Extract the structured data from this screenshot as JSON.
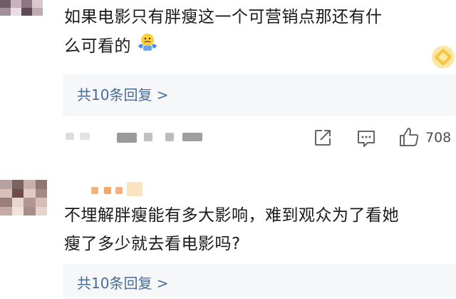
{
  "comments": [
    {
      "text_line1": "如果电影只有胖瘦这一个可营销点那还有什",
      "text_line2": "么可看的",
      "emoji": "shrug-emoji",
      "replies_link": "共10条回复 >",
      "like_count": "708"
    },
    {
      "text_line1": "不埋解胖瘦能有多大影响，难到观众为了看她",
      "text_line2": "瘦了多少就去看电影吗?",
      "replies_link": "共10条回复 >"
    }
  ],
  "icons": {
    "share": "share-icon",
    "comment": "comment-icon",
    "like": "thumbs-up-icon",
    "badge": "gold-badge-icon"
  },
  "colors": {
    "link": "#4a6c95",
    "reply_bg": "#f6f7f9",
    "badge": "#f4c542"
  }
}
